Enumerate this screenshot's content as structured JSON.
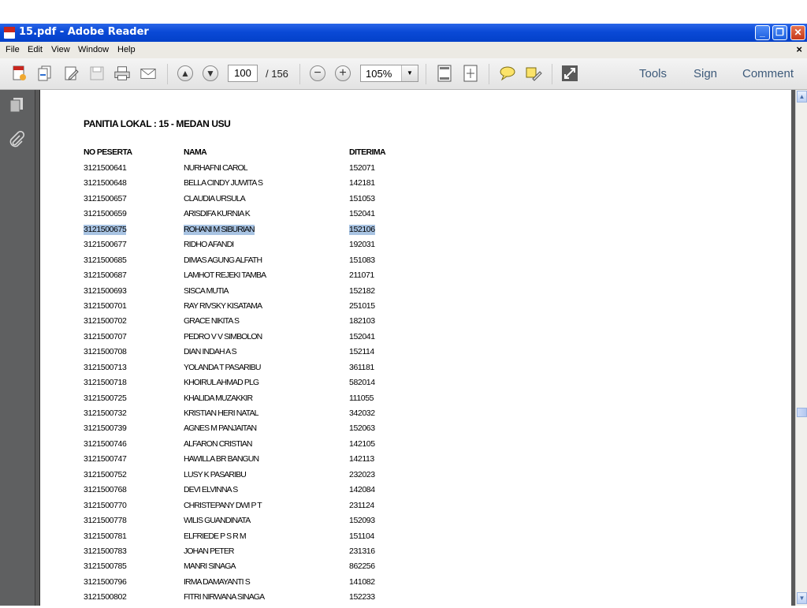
{
  "window": {
    "title": "15.pdf - Adobe Reader"
  },
  "menu": {
    "items": [
      "File",
      "Edit",
      "View",
      "Window",
      "Help"
    ]
  },
  "toolbar": {
    "page_current": "100",
    "page_total": "/ 156",
    "zoom": "105%",
    "tools_label": "Tools",
    "sign_label": "Sign",
    "comment_label": "Comment"
  },
  "document": {
    "heading": "PANITIA LOKAL : 15 - MEDAN USU",
    "columns": [
      "NO PESERTA",
      "NAMA",
      "DITERIMA"
    ],
    "rows": [
      {
        "no": "3121500641",
        "nama": "NURHAFNI CAROL",
        "diterima": "152071"
      },
      {
        "no": "3121500648",
        "nama": "BELLA CINDY JUWITA S",
        "diterima": "142181"
      },
      {
        "no": "3121500657",
        "nama": "CLAUDIA URSULA",
        "diterima": "151053"
      },
      {
        "no": "3121500659",
        "nama": "ARISDIFA KURNIA K",
        "diterima": "152041"
      },
      {
        "no": "3121500675",
        "nama": "ROHANI M SIBURIAN",
        "diterima": "152106",
        "selected": true
      },
      {
        "no": "3121500677",
        "nama": "RIDHO AFANDI",
        "diterima": "192031"
      },
      {
        "no": "3121500685",
        "nama": "DIMAS AGUNG ALFATH",
        "diterima": "151083"
      },
      {
        "no": "3121500687",
        "nama": "LAMHOT REJEKI TAMBA",
        "diterima": "211071"
      },
      {
        "no": "3121500693",
        "nama": "SISCA MUTIA",
        "diterima": "152182"
      },
      {
        "no": "3121500701",
        "nama": "RAY RIVSKY KISATAMA",
        "diterima": "251015"
      },
      {
        "no": "3121500702",
        "nama": "GRACE NIKITA S",
        "diterima": "182103"
      },
      {
        "no": "3121500707",
        "nama": "PEDRO V V SIMBOLON",
        "diterima": "152041"
      },
      {
        "no": "3121500708",
        "nama": "DIAN INDAH A S",
        "diterima": "152114"
      },
      {
        "no": "3121500713",
        "nama": "YOLANDA T PASARIBU",
        "diterima": "361181"
      },
      {
        "no": "3121500718",
        "nama": "KHOIRUL AHMAD PLG",
        "diterima": "582014"
      },
      {
        "no": "3121500725",
        "nama": "KHALIDA MUZAKKIR",
        "diterima": "111055"
      },
      {
        "no": "3121500732",
        "nama": "KRISTIAN HERI NATAL",
        "diterima": "342032"
      },
      {
        "no": "3121500739",
        "nama": "AGNES M PANJAITAN",
        "diterima": "152063"
      },
      {
        "no": "3121500746",
        "nama": "ALFARON CRISTIAN",
        "diterima": "142105"
      },
      {
        "no": "3121500747",
        "nama": "HAWILLA BR BANGUN",
        "diterima": "142113"
      },
      {
        "no": "3121500752",
        "nama": "LUSY K PASARIBU",
        "diterima": "232023"
      },
      {
        "no": "3121500768",
        "nama": "DEVI ELVINNA S",
        "diterima": "142084"
      },
      {
        "no": "3121500770",
        "nama": "CHRISTEPANY DWI P T",
        "diterima": "231124"
      },
      {
        "no": "3121500778",
        "nama": "WILIS GUANDINATA",
        "diterima": "152093"
      },
      {
        "no": "3121500781",
        "nama": "ELFRIEDE P S R M",
        "diterima": "151104"
      },
      {
        "no": "3121500783",
        "nama": "JOHAN PETER",
        "diterima": "231316"
      },
      {
        "no": "3121500785",
        "nama": "MANRI SINAGA",
        "diterima": "862256"
      },
      {
        "no": "3121500796",
        "nama": "IRMA DAMAYANTI S",
        "diterima": "141082"
      },
      {
        "no": "3121500802",
        "nama": "FITRI NIRWANA SINAGA",
        "diterima": "152233"
      }
    ]
  },
  "icons": {
    "app": "pdf-document-icon",
    "toolbar": [
      "create-pdf-icon",
      "combine-files-icon",
      "edit-document-icon",
      "save-icon",
      "print-icon",
      "email-icon",
      "previous-page-icon",
      "next-page-icon",
      "zoom-out-icon",
      "zoom-in-icon",
      "fit-page-icon",
      "full-page-icon",
      "comment-bubble-icon",
      "highlight-text-icon",
      "fullscreen-icon"
    ],
    "leftnav": [
      "pages-panel-icon",
      "attachments-icon"
    ]
  },
  "colors": {
    "titlebar": "#0a49d6",
    "selection": "#a8c3e2",
    "nav_panel": "#5f6061",
    "doc_background": "#595959"
  }
}
